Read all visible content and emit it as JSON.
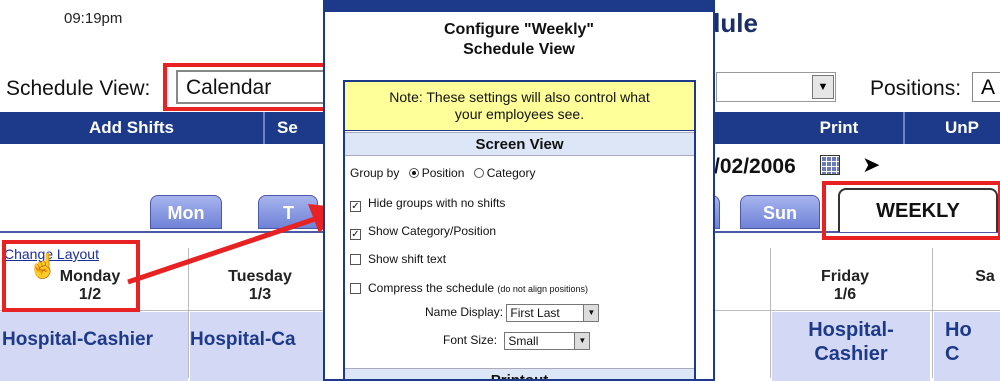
{
  "app": {
    "time": "09:19pm",
    "title_fragment": "edule",
    "schedule_view": {
      "label": "Schedule View:",
      "value": "Calendar"
    },
    "positions": {
      "label": "Positions:",
      "value": "A"
    },
    "toolbar": [
      {
        "label": "Add Shifts"
      },
      {
        "label": "Se"
      },
      {
        "label": "Print"
      },
      {
        "label": "UnP"
      }
    ],
    "date": "/02/2006",
    "tabs": [
      {
        "label": "Mon"
      },
      {
        "label": "T"
      },
      {
        "label": "Sun"
      },
      {
        "label": "WEEKLY"
      }
    ],
    "change_layout": "Change Layout",
    "days": [
      {
        "name": "Monday",
        "date": "1/2"
      },
      {
        "name": "Tuesday",
        "date": "1/3"
      },
      {
        "name": "Friday",
        "date": "1/6"
      },
      {
        "name": "Sa",
        "date": ""
      }
    ],
    "cells": [
      {
        "line1": "Hospital-Cashier",
        "line2": ""
      },
      {
        "line1": "Hospital-Ca",
        "line2": ""
      },
      {
        "line1": "Hospital-",
        "line2": "Cashier"
      },
      {
        "line1": "Ho",
        "line2": "C"
      }
    ]
  },
  "dialog": {
    "title_line1": "Configure \"Weekly\"",
    "title_line2": "Schedule View",
    "note_line1": "Note: These settings will also control what",
    "note_line2": "your employees see.",
    "screen_view_header": "Screen View",
    "group_by": {
      "label": "Group by",
      "options": [
        {
          "label": "Position",
          "selected": true
        },
        {
          "label": "Category",
          "selected": false
        }
      ]
    },
    "checkboxes": [
      {
        "label": "Hide groups with no shifts",
        "checked": true
      },
      {
        "label": "Show Category/Position",
        "checked": true
      },
      {
        "label": "Show shift text",
        "checked": false
      },
      {
        "label": "Compress the schedule",
        "hint": "(do not align positions)",
        "checked": false
      }
    ],
    "name_display": {
      "label": "Name Display:",
      "value": "First Last"
    },
    "font_size": {
      "label": "Font Size:",
      "value": "Small"
    },
    "printout_header": "Printout"
  },
  "icons": {
    "calendar": "calendar-icon",
    "next": "next-arrow-icon",
    "hand": "hand-pointer-icon",
    "dropdown": "chevron-down-icon"
  },
  "colors": {
    "navy": "#1d3a8a",
    "tab_blue": "#6f82d6",
    "highlight_red": "#e82222",
    "note_yellow": "#ffff99",
    "cell_bg": "#d3d8f4"
  }
}
